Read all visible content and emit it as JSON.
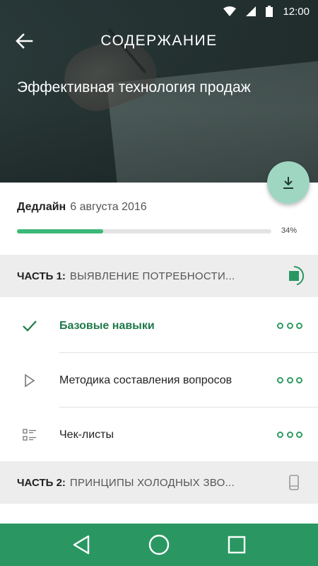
{
  "status_bar": {
    "time": "12:00",
    "icons": [
      "wifi-icon",
      "signal-icon",
      "battery-icon"
    ]
  },
  "header": {
    "title": "СОДЕРЖАНИЕ",
    "back_icon": "arrow-left-icon",
    "course_title": "Эффективная технология продаж",
    "fab_icon": "download-icon"
  },
  "deadline": {
    "label": "Дедлайн",
    "date": "6 августа 2016",
    "progress": 0.34,
    "progress_text": "34%"
  },
  "sections": [
    {
      "part": "ЧАСТЬ 1:",
      "name": "ВЫЯВЛЕНИЕ ПОТРЕБНОСТИ...",
      "status_icon": "downloading-stop-icon",
      "lessons": [
        {
          "title": "Базовые навыки",
          "icon": "check-icon",
          "state": "done",
          "more_icon": "more-dots-icon"
        },
        {
          "title": "Методика составления вопросов",
          "icon": "play-icon",
          "state": "todo",
          "more_icon": "more-dots-icon"
        },
        {
          "title": "Чек-листы",
          "icon": "checklist-icon",
          "state": "todo",
          "more_icon": "more-dots-icon"
        }
      ]
    },
    {
      "part": "ЧАСТЬ 2:",
      "name": "ПРИНЦИПЫ ХОЛОДНЫХ ЗВО...",
      "status_icon": "phone-device-icon",
      "lessons": []
    }
  ],
  "navbar": {
    "buttons": [
      "back-triangle-icon",
      "home-circle-icon",
      "recents-square-icon"
    ]
  },
  "colors": {
    "accent": "#2a9762",
    "progress": "#3cb878",
    "fab": "#9fd6c2",
    "done_text": "#1f7a4a"
  }
}
